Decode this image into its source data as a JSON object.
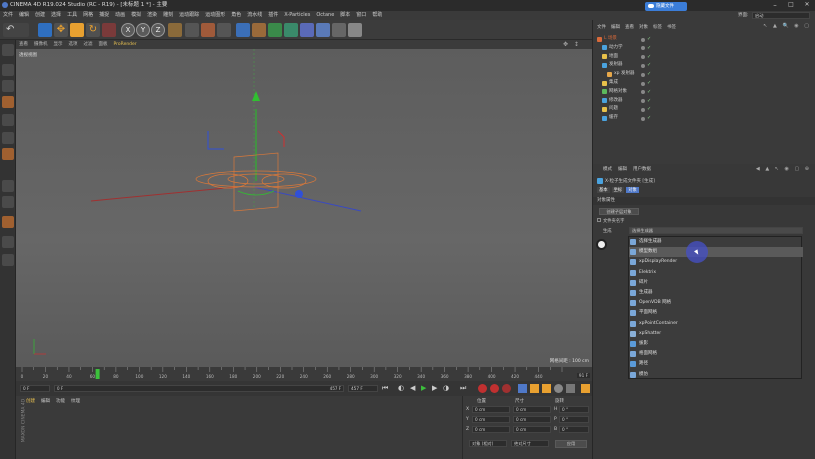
{
  "title": "CINEMA 4D R19.024 Studio (RC - R19) - [未标题 1 *] - 主要",
  "window_controls": {
    "minimize": "–",
    "maximize": "□",
    "close": "✕"
  },
  "overlay_button": "隐藏文件",
  "menu": [
    "文件",
    "编辑",
    "创建",
    "选择",
    "工具",
    "网格",
    "捕捉",
    "动画",
    "模拟",
    "渲染",
    "雕刻",
    "运动跟踪",
    "运动图形",
    "角色",
    "流水线",
    "插件",
    "X-Particles",
    "Octane",
    "脚本",
    "窗口",
    "帮助"
  ],
  "layout": {
    "label": "界面:",
    "value": "启动"
  },
  "toolbar": {
    "x": "X",
    "y": "Y",
    "z": "Z"
  },
  "viewport": {
    "menu": [
      "查看",
      "摄像机",
      "显示",
      "选项",
      "过滤",
      "面板",
      "ProRender"
    ],
    "label": "透视视图",
    "grid_spacing": "网格间距 : 100 cm"
  },
  "timeline": {
    "ticks": [
      "0",
      "10",
      "20",
      "30",
      "40",
      "50",
      "60",
      "70",
      "80",
      "90",
      "100",
      "110",
      "120",
      "130",
      "140",
      "150",
      "160",
      "170",
      "180",
      "190",
      "200",
      "210",
      "220",
      "230",
      "240",
      "250",
      "260",
      "270",
      "280",
      "290",
      "300",
      "310",
      "320",
      "330",
      "340",
      "350",
      "360",
      "370",
      "380",
      "390",
      "400",
      "410",
      "420",
      "430",
      "440",
      "450",
      "460"
    ],
    "visible_labels": [
      "0",
      "20",
      "40",
      "60",
      "80",
      "100",
      "120",
      "140",
      "160",
      "180",
      "200",
      "220",
      "240",
      "260",
      "280",
      "300",
      "320",
      "340",
      "360",
      "380",
      "400",
      "420",
      "440"
    ],
    "current_frame": "91 F",
    "playhead_fraction": 0.14
  },
  "playbar": {
    "start": "0 F",
    "end_field": "457 F",
    "start2": "0 F",
    "end2": "457 F"
  },
  "materials": {
    "tabs": [
      "创建",
      "编辑",
      "功能",
      "纹理"
    ]
  },
  "coords": {
    "headers": [
      "位置",
      "尺寸",
      "旋转"
    ],
    "rows": [
      {
        "axis": "X",
        "pos": "0 cm",
        "size": "0 cm",
        "rot_label": "H",
        "rot": "0 °"
      },
      {
        "axis": "Y",
        "pos": "0 cm",
        "size": "0 cm",
        "rot_label": "P",
        "rot": "0 °"
      },
      {
        "axis": "Z",
        "pos": "0 cm",
        "size": "0 cm",
        "rot_label": "B",
        "rot": "0 °"
      }
    ],
    "mode": "对象 (相对)",
    "size_mode": "绝对尺寸",
    "apply": "应用"
  },
  "objects": {
    "tabs": [
      "文件",
      "编辑",
      "查看",
      "对象",
      "标签",
      "书签"
    ],
    "items": [
      {
        "name": "L 场景",
        "indent": 0,
        "color": "#d86a3a"
      },
      {
        "name": "动力学",
        "indent": 1,
        "color": "#4aa3df"
      },
      {
        "name": "地面",
        "indent": 1,
        "color": "#e8c14a"
      },
      {
        "name": "发射器",
        "indent": 1,
        "color": "#4aa3df"
      },
      {
        "name": "xp 发射器",
        "indent": 2,
        "color": "#e8a84a"
      },
      {
        "name": "集成",
        "indent": 1,
        "color": "#e8c14a"
      },
      {
        "name": "网格对象",
        "indent": 1,
        "color": "#5cb85c"
      },
      {
        "name": "修改器",
        "indent": 1,
        "color": "#4aa3df"
      },
      {
        "name": "问题",
        "indent": 1,
        "color": "#e8c14a"
      },
      {
        "name": "缓存",
        "indent": 1,
        "color": "#4aa3df"
      }
    ]
  },
  "attributes": {
    "tabs": [
      "模式",
      "编辑",
      "用户数据"
    ],
    "object_title": "X-粒子生成文件夹 [生成]",
    "subtabs": [
      "基本",
      "坐标",
      "对象"
    ],
    "section": "对象属性",
    "button": "创建子层对象",
    "checkbox_label": "文件夹名字",
    "generator_label": "生成",
    "generator_value": "选择生成器",
    "dropdown": [
      "选择生成器",
      "模型数组",
      "xpDisplayRender",
      "Elektrix",
      "碎片",
      "生成器",
      "OpenVDB 网格",
      "平面网格",
      "xpPointContainer",
      "xpShatter",
      "拔影",
      "格面网格",
      "路径",
      "模仿"
    ],
    "highlighted_index": 1
  },
  "colors": {
    "accent": "#4f78c8",
    "highlight_row": "#5a5a5a",
    "axis_x": "#d03030",
    "axis_y": "#30c030",
    "axis_z": "#3050d0",
    "object": "#d8783a"
  }
}
